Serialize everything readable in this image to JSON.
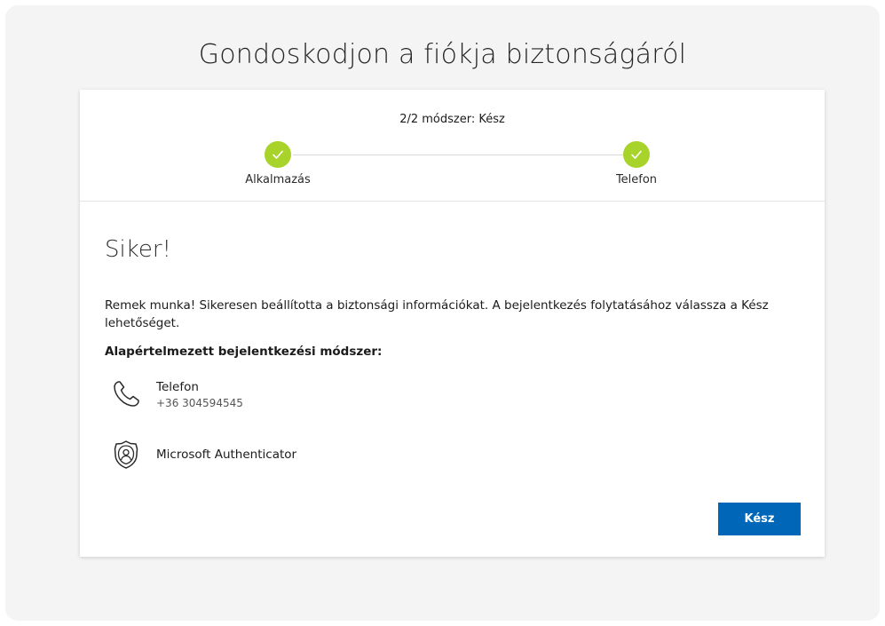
{
  "page": {
    "title": "Gondoskodjon a fiókja biztonságáról"
  },
  "progress": {
    "label": "2/2 módszer: Kész",
    "steps": [
      {
        "label": "Alkalmazás",
        "status": "complete"
      },
      {
        "label": "Telefon",
        "status": "complete"
      }
    ],
    "complete_color": "#a8d32a"
  },
  "result": {
    "title": "Siker!",
    "message": "Remek munka! Sikeresen beállította a biztonsági információkat. A bejelentkezés folytatásához válassza a Kész lehetőséget.",
    "default_method_label": "Alapértelmezett bejelentkezési módszer:"
  },
  "methods": [
    {
      "icon": "phone-icon",
      "name": "Telefon",
      "detail": "+36 304594545"
    },
    {
      "icon": "authenticator-icon",
      "name": "Microsoft Authenticator"
    }
  ],
  "actions": {
    "done_label": "Kész",
    "primary_color": "#0067b8"
  }
}
